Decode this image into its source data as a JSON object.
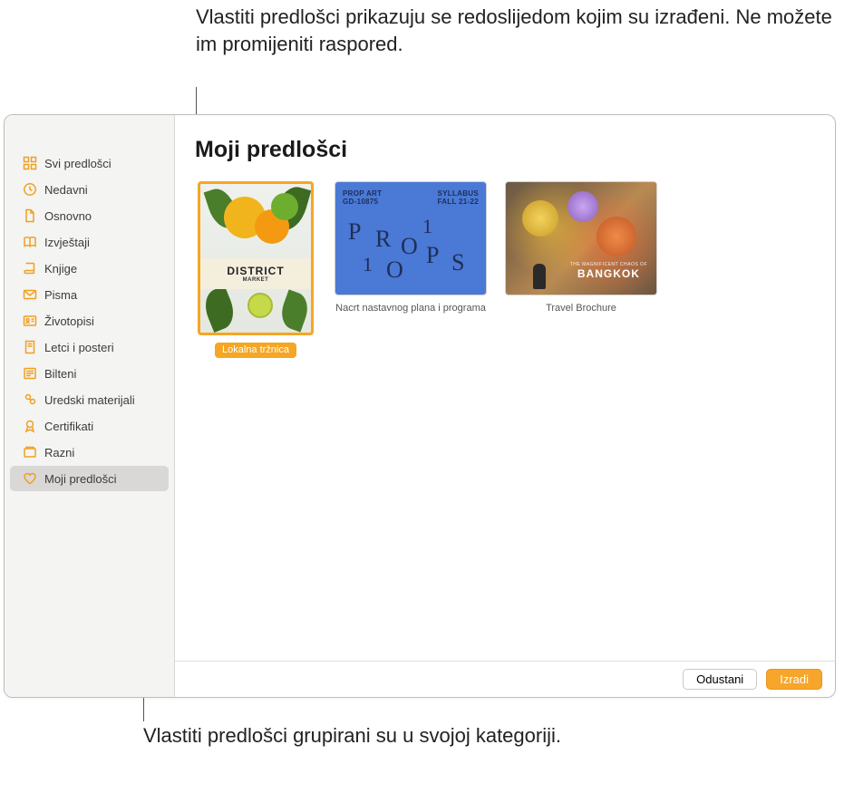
{
  "callouts": {
    "top": "Vlastiti predlošci prikazuju se redoslijedom kojim su izrađeni. Ne možete im promijeniti raspored.",
    "bottom": "Vlastiti predlošci grupirani su u svojoj kategoriji."
  },
  "sidebar": {
    "items": [
      {
        "label": "Svi predlošci",
        "icon": "grid"
      },
      {
        "label": "Nedavni",
        "icon": "clock"
      },
      {
        "label": "Osnovno",
        "icon": "doc"
      },
      {
        "label": "Izvještaji",
        "icon": "book-open"
      },
      {
        "label": "Knjige",
        "icon": "book"
      },
      {
        "label": "Pisma",
        "icon": "envelope"
      },
      {
        "label": "Životopisi",
        "icon": "card"
      },
      {
        "label": "Letci i posteri",
        "icon": "doc"
      },
      {
        "label": "Bilteni",
        "icon": "list"
      },
      {
        "label": "Uredski materijali",
        "icon": "tag"
      },
      {
        "label": "Certifikati",
        "icon": "ribbon"
      },
      {
        "label": "Razni",
        "icon": "collection"
      },
      {
        "label": "Moji predlošci",
        "icon": "heart",
        "selected": true
      }
    ]
  },
  "main": {
    "title": "Moji predlošci",
    "templates": [
      {
        "label": "Lokalna tržnica",
        "selected": true,
        "thumb": {
          "brand_line1": "DISTRICT",
          "brand_line2": "MARKET"
        }
      },
      {
        "label": "Nacrt nastavnog plana i programa",
        "thumb": {
          "top_left_l1": "PROP ART",
          "top_left_l2": "GD-10875",
          "top_right_l1": "SYLLABUS",
          "top_right_l2": "FALL 21-22",
          "letters": [
            "P",
            "R",
            "O",
            "1",
            "1",
            "O",
            "P",
            "S"
          ]
        }
      },
      {
        "label": "Travel Brochure",
        "thumb": {
          "small": "THE MAGNIFICENT CHAOS OF",
          "big": "BANGKOK"
        }
      }
    ]
  },
  "footer": {
    "cancel": "Odustani",
    "create": "Izradi"
  }
}
